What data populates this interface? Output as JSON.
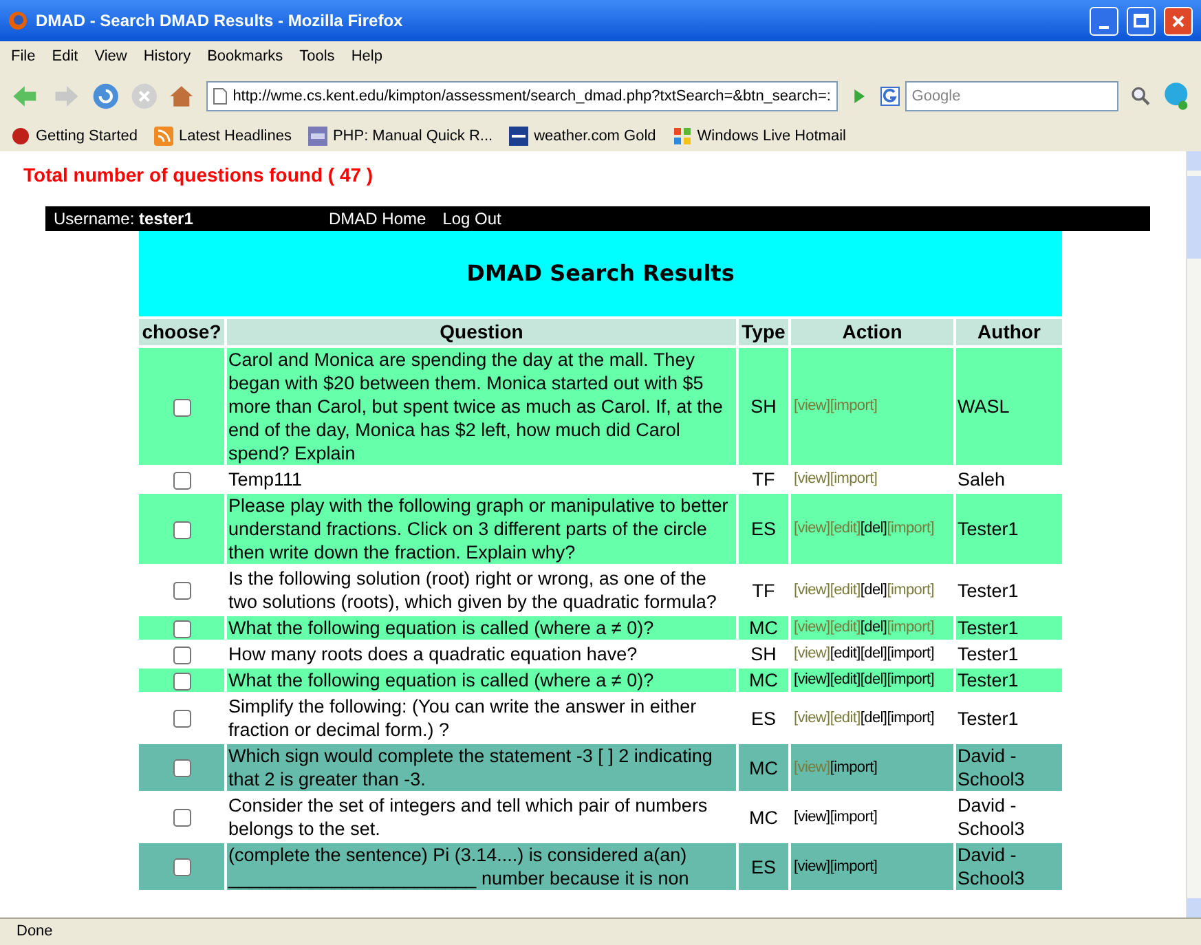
{
  "window": {
    "title": "DMAD - Search DMAD Results - Mozilla Firefox"
  },
  "menu": [
    "File",
    "Edit",
    "View",
    "History",
    "Bookmarks",
    "Tools",
    "Help"
  ],
  "address": {
    "value": "http://wme.cs.kent.edu/kimpton/assessment/search_dmad.php?txtSearch=&btn_search=:"
  },
  "search": {
    "placeholder": "Google"
  },
  "bookmarks": [
    {
      "label": "Getting Started",
      "kind": "star"
    },
    {
      "label": "Latest Headlines",
      "kind": "feed"
    },
    {
      "label": "PHP: Manual Quick R...",
      "kind": "php"
    },
    {
      "label": "weather.com Gold",
      "kind": "twc"
    },
    {
      "label": "Windows Live Hotmail",
      "kind": "windows"
    }
  ],
  "total": "Total number of questions found ( 47 )",
  "userbar": {
    "label": "Username:",
    "user": "tester1",
    "links": [
      "DMAD Home",
      "Log Out"
    ]
  },
  "heading": "DMAD Search Results",
  "columns": [
    "choose?",
    "Question",
    "Type",
    "Action",
    "Author"
  ],
  "rows": [
    {
      "color": "#66ffaa",
      "checked": false,
      "question": "Carol and Monica are spending the day at the mall. They began with $20 between them. Monica started out with $5 more than Carol, but spent twice as much as Carol. If, at the end of the day, Monica has $2 left, how much did Carol spend? Explain",
      "type": "SH",
      "actions": [
        {
          "label": "[view]",
          "visited": true
        },
        {
          "label": "[import]",
          "visited": true
        }
      ],
      "author": "WASL"
    },
    {
      "color": "#ffffff",
      "checked": false,
      "question": "Temp111",
      "type": "TF",
      "actions": [
        {
          "label": "[view]",
          "visited": true
        },
        {
          "label": "[import]",
          "visited": true
        }
      ],
      "author": "Saleh"
    },
    {
      "color": "#66ffaa",
      "checked": false,
      "question": "Please play with the following graph or manipulative to better understand fractions. Click on 3 different parts of the circle then write down the fraction. Explain why?",
      "type": "ES",
      "actions": [
        {
          "label": "[view]",
          "visited": true
        },
        {
          "label": "[edit]",
          "visited": true
        },
        {
          "label": "[del]",
          "visited": false
        },
        {
          "label": "[import]",
          "visited": true
        }
      ],
      "author": "Tester1"
    },
    {
      "color": "#ffffff",
      "checked": false,
      "question": "Is the following solution (root) right or wrong, as one of the two solutions (roots), which given by the quadratic formula?",
      "type": "TF",
      "actions": [
        {
          "label": "[view]",
          "visited": true
        },
        {
          "label": "[edit]",
          "visited": true
        },
        {
          "label": "[del]",
          "visited": false
        },
        {
          "label": "[import]",
          "visited": true
        }
      ],
      "author": "Tester1"
    },
    {
      "color": "#66ffaa",
      "checked": false,
      "question": "What the following equation is called (where a ≠ 0)?",
      "type": "MC",
      "actions": [
        {
          "label": "[view]",
          "visited": true
        },
        {
          "label": "[edit]",
          "visited": true
        },
        {
          "label": "[del]",
          "visited": false
        },
        {
          "label": "[import]",
          "visited": true
        }
      ],
      "author": "Tester1"
    },
    {
      "color": "#ffffff",
      "checked": false,
      "question": "How many roots does a quadratic equation have?",
      "type": "SH",
      "actions": [
        {
          "label": "[view]",
          "visited": true
        },
        {
          "label": "[edit]",
          "visited": false
        },
        {
          "label": "[del]",
          "visited": false
        },
        {
          "label": "[import]",
          "visited": false
        }
      ],
      "author": "Tester1"
    },
    {
      "color": "#66ffaa",
      "checked": false,
      "question": "What the following equation is called (where a ≠ 0)?",
      "type": "MC",
      "actions": [
        {
          "label": "[view]",
          "visited": false
        },
        {
          "label": "[edit]",
          "visited": false
        },
        {
          "label": "[del]",
          "visited": false
        },
        {
          "label": "[import]",
          "visited": false
        }
      ],
      "author": "Tester1"
    },
    {
      "color": "#ffffff",
      "checked": false,
      "question": "Simplify the following: (You can write the answer in either fraction or decimal form.) ?",
      "type": "ES",
      "actions": [
        {
          "label": "[view]",
          "visited": true
        },
        {
          "label": "[edit]",
          "visited": true
        },
        {
          "label": "[del]",
          "visited": false
        },
        {
          "label": "[import]",
          "visited": false
        }
      ],
      "author": "Tester1"
    },
    {
      "color": "#66bbaa",
      "checked": false,
      "question": "Which sign would complete the statement -3 [ ] 2 indicating that 2 is greater than -3.",
      "type": "MC",
      "actions": [
        {
          "label": "[view]",
          "visited": true
        },
        {
          "label": "[import]",
          "visited": false
        }
      ],
      "author": "David - School3"
    },
    {
      "color": "#ffffff",
      "checked": false,
      "question": "Consider the set of integers and tell which pair of numbers belongs to the set.",
      "type": "MC",
      "actions": [
        {
          "label": "[view]",
          "visited": false
        },
        {
          "label": "[import]",
          "visited": false
        }
      ],
      "author": "David - School3"
    },
    {
      "color": "#66bbaa",
      "checked": false,
      "question": "(complete the sentence) Pi (3.14....) is considered a(an) ________________________ number because it is non",
      "type": "ES",
      "actions": [
        {
          "label": "[view]",
          "visited": false
        },
        {
          "label": "[import]",
          "visited": false
        }
      ],
      "author": "David - School3"
    }
  ],
  "status_bar": "Done"
}
